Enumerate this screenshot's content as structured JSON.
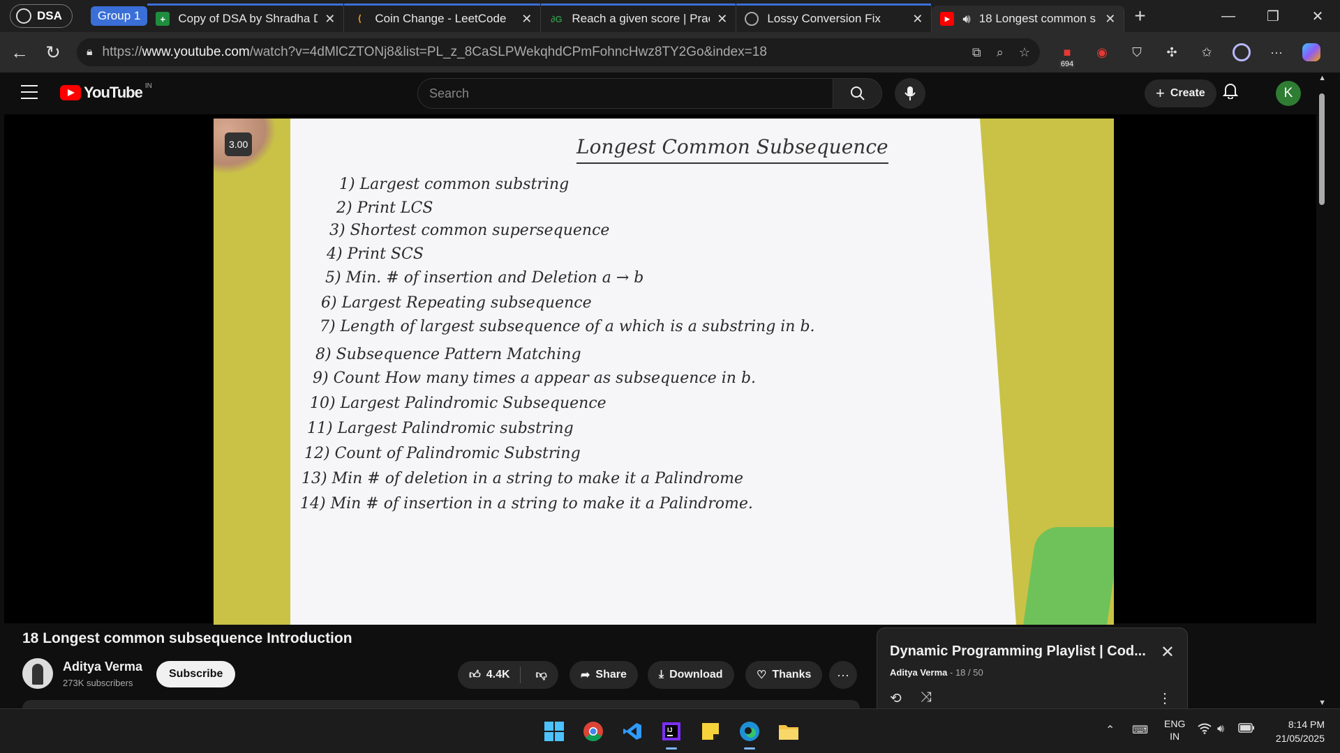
{
  "browser": {
    "profile_label": "DSA",
    "group_label": "Group 1",
    "tabs": [
      {
        "title": "Copy of DSA by Shradha D",
        "icon": "sheets-icon"
      },
      {
        "title": "Coin Change - LeetCode",
        "icon": "leetcode-icon"
      },
      {
        "title": "Reach a given score | Pract",
        "icon": "gfg-icon"
      },
      {
        "title": "Lossy Conversion Fix",
        "icon": "chatgpt-icon"
      },
      {
        "title": "18 Longest common s",
        "icon": "youtube-icon"
      }
    ],
    "url_prefix": "https://",
    "url_host": "www.youtube.com",
    "url_path": "/watch?v=4dMlCZTONj8&list=PL_z_8CaSLPWekqhdCPmFohncHwz8TY2Go&index=18",
    "ext_badge": "694"
  },
  "youtube": {
    "logo_text": "YouTube",
    "region": "IN",
    "search_placeholder": "Search",
    "create_label": "Create",
    "avatar_letter": "K",
    "video": {
      "speed": "3.00",
      "note_title": "Longest Common Subsequence",
      "note_lines": [
        "1) Largest common substring",
        "2) Print LCS",
        "3) Shortest common supersequence",
        "4) Print SCS",
        "5) Min. # of insertion and Deletion a → b",
        "6) Largest Repeating subsequence",
        "7) Length of largest subsequence of a which is a substring in b.",
        "8) Subsequence Pattern Matching",
        "9) Count How many times a appear as subsequence in b.",
        "10) Largest Palindromic Subsequence",
        "11) Largest Palindromic substring",
        "12) Count of Palindromic Substring",
        "13) Min # of deletion in a string to make it a Palindrome",
        "14) Min # of insertion in a string to make it a Palindrome."
      ]
    },
    "title": "18 Longest common subsequence Introduction",
    "channel": {
      "name": "Aditya Verma",
      "subscribers": "273K subscribers"
    },
    "subscribe_label": "Subscribe",
    "likes": "4.4K",
    "share_label": "Share",
    "download_label": "Download",
    "thanks_label": "Thanks",
    "playlist": {
      "title": "Dynamic Programming Playlist | Cod...",
      "owner": "Aditya Verma",
      "position": "18 / 50"
    }
  },
  "taskbar": {
    "lang_top": "ENG",
    "lang_bottom": "IN",
    "time": "8:14 PM",
    "date": "21/05/2025"
  },
  "colors": {
    "youtube_red": "#ff0000",
    "group_blue": "#3b6fd8",
    "avatar_green": "#2e7d32"
  }
}
